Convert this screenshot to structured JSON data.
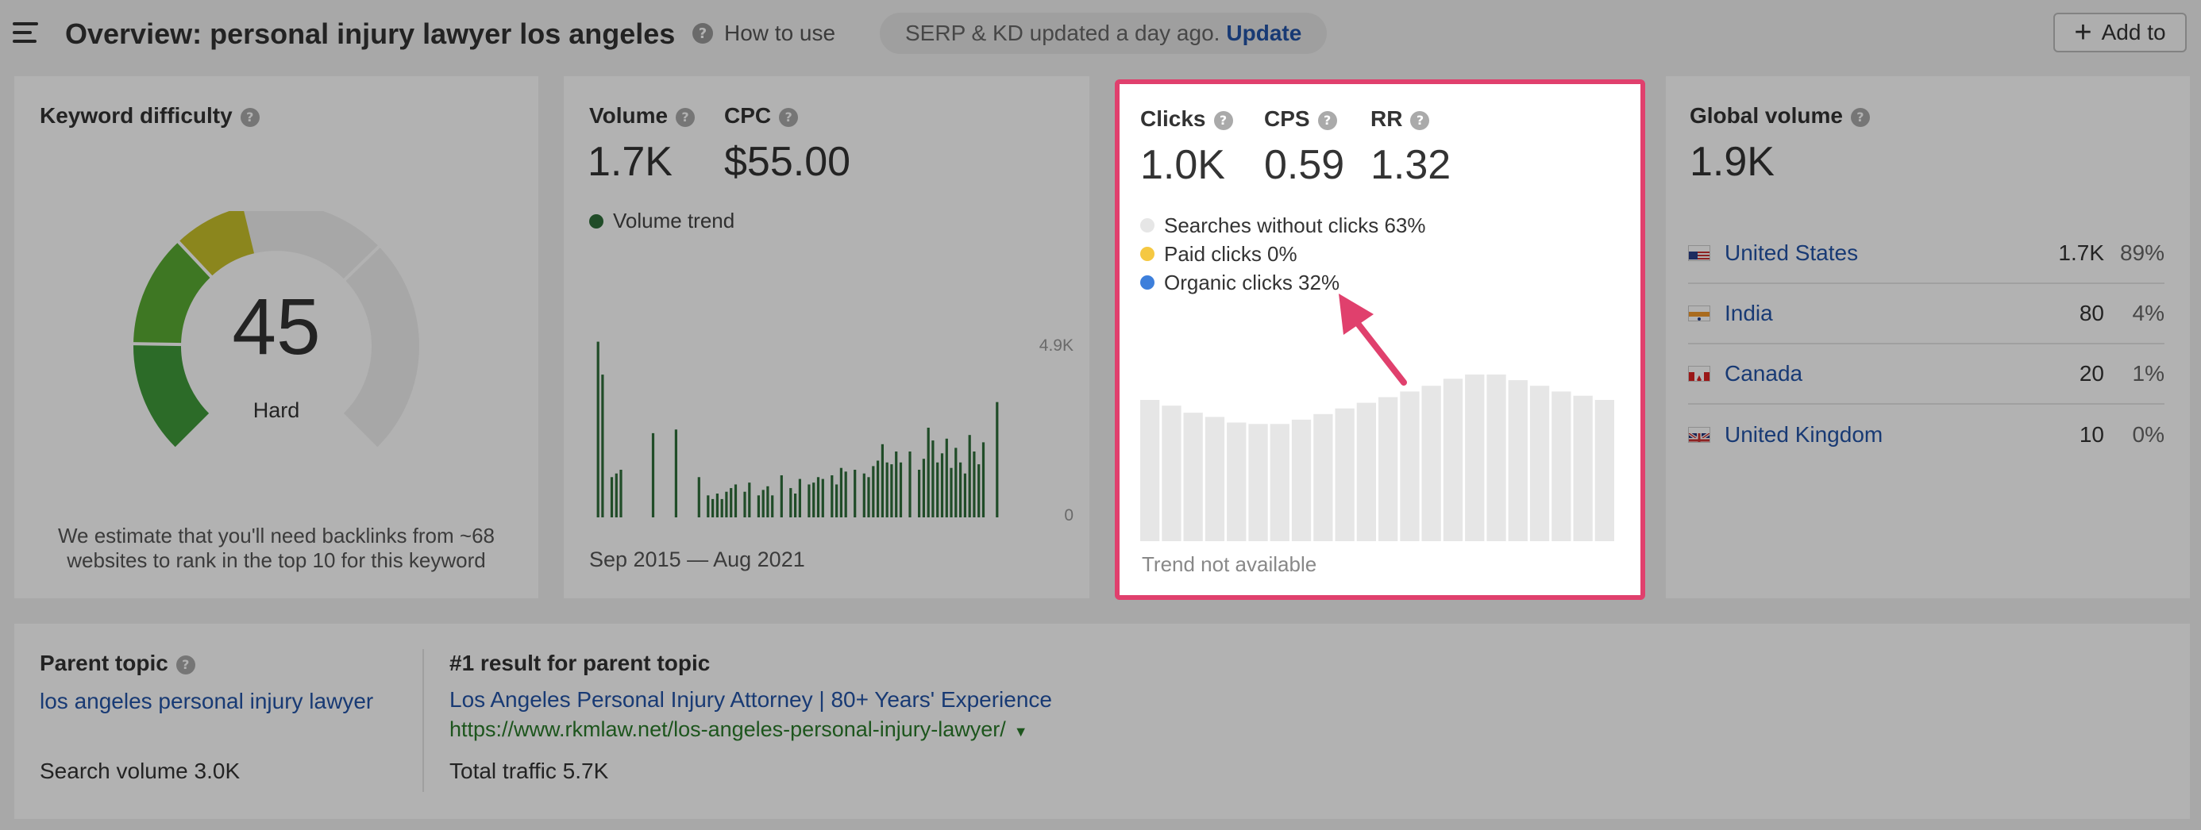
{
  "header": {
    "title": "Overview: personal injury lawyer los angeles",
    "help_link": "How to use",
    "status_text": "SERP & KD updated a day ago.",
    "update_label": "Update",
    "add_to_label": "Add to",
    "menu_icon": "hamburger-icon"
  },
  "keyword_difficulty": {
    "label": "Keyword difficulty",
    "value": "45",
    "rating": "Hard",
    "score_fraction": 0.45,
    "description": "We estimate that you'll need backlinks from ~68 websites to rank in the top 10 for this keyword"
  },
  "volume": {
    "label": "Volume",
    "value": "1.7K",
    "cpc_label": "CPC",
    "cpc_value": "$55.00",
    "trend_label": "Volume trend",
    "trend_color": "#2f6e3a",
    "axis_max": "4.9K",
    "axis_min": "0",
    "date_range": "Sep 2015 — Aug 2021"
  },
  "clicks": {
    "label": "Clicks",
    "value": "1.0K",
    "cps_label": "CPS",
    "cps_value": "0.59",
    "rr_label": "RR",
    "rr_value": "1.32",
    "breakdown": [
      {
        "label": "Searches without clicks 63%",
        "color": "#e6e6e6"
      },
      {
        "label": "Paid clicks 0%",
        "color": "#f5c842"
      },
      {
        "label": "Organic clicks 32%",
        "color": "#3d7fdb"
      }
    ],
    "trend_text": "Trend not available",
    "highlight_color": "#e0406d"
  },
  "global_volume": {
    "label": "Global volume",
    "value": "1.9K",
    "countries": [
      {
        "name": "United States",
        "volume": "1.7K",
        "share": "89%",
        "flag": "us-flag-icon"
      },
      {
        "name": "India",
        "volume": "80",
        "share": "4%",
        "flag": "india-flag-icon"
      },
      {
        "name": "Canada",
        "volume": "20",
        "share": "1%",
        "flag": "canada-flag-icon"
      },
      {
        "name": "United Kingdom",
        "volume": "10",
        "share": "0%",
        "flag": "uk-flag-icon"
      }
    ]
  },
  "parent_topic": {
    "label": "Parent topic",
    "topic": "los angeles personal injury lawyer",
    "search_volume": "Search volume 3.0K",
    "result_label": "#1 result for parent topic",
    "result_title": "Los Angeles Personal Injury Attorney | 80+ Years' Experience",
    "result_url": "https://www.rkmlaw.net/los-angeles-personal-injury-lawyer/",
    "total_traffic": "Total traffic 5.7K"
  },
  "chart_data": [
    {
      "type": "bar",
      "title": "Volume trend",
      "x_range": [
        "Sep 2015",
        "Aug 2021"
      ],
      "ylim": [
        0,
        4900
      ],
      "values": [
        0,
        0,
        4800,
        3900,
        0,
        1100,
        1200,
        1300,
        0,
        0,
        0,
        0,
        0,
        0,
        2300,
        0,
        0,
        0,
        0,
        2400,
        0,
        0,
        0,
        0,
        1100,
        0,
        600,
        500,
        650,
        500,
        700,
        800,
        900,
        0,
        700,
        950,
        0,
        600,
        750,
        850,
        600,
        0,
        1150,
        0,
        800,
        650,
        1050,
        0,
        900,
        950,
        1100,
        1050,
        0,
        1150,
        900,
        1350,
        1250,
        0,
        1300,
        0,
        1200,
        1100,
        1400,
        1550,
        2000,
        1500,
        1450,
        1800,
        1500,
        0,
        1800,
        0,
        1300,
        1600,
        2450,
        2100,
        1500,
        1750,
        2150,
        1350,
        1900,
        1500,
        1200,
        2250,
        1800,
        1450,
        2050,
        0,
        0,
        3150
      ],
      "grid": false
    },
    {
      "type": "bar",
      "title": "Clicks trend",
      "values": [
        100,
        96,
        91,
        88,
        84,
        83,
        83,
        86,
        90,
        94,
        98,
        102,
        106,
        110,
        115,
        118,
        118,
        114,
        110,
        106,
        103,
        100
      ],
      "grid": false
    }
  ]
}
